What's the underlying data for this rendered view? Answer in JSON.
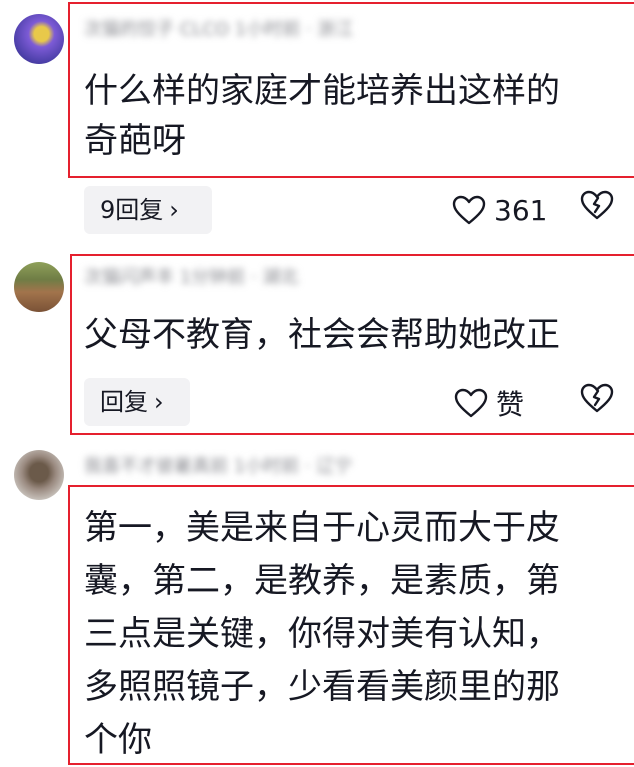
{
  "comments": [
    {
      "author_meta": "次猫的饺子 CLCO  1小时前 · 浙江",
      "text": "什么样的家庭才能培养出这样的\n奇葩呀",
      "reply_label": "9回复",
      "likes": "361"
    },
    {
      "author_meta": "次猫闪声丰  1分钟前 · 湖北",
      "text": "父母不教育，社会会帮助她改正",
      "reply_label": "回复",
      "likes": "赞"
    },
    {
      "author_meta": "我喜不才彼暑真前  1小时前 · 辽宁",
      "text": "第一，美是来自于心灵而大于皮\n囊，第二，是教养，是素质，第\n三点是关键，你得对美有认知，\n多照照镜子，少看看美颜里的那\n个你"
    }
  ],
  "colors": {
    "highlight_border": "#e5202e",
    "meta_text": "#8a8b91",
    "pill_bg": "#f2f2f4"
  },
  "icons": {
    "reply_chevron": "chevron-right-icon",
    "like": "heart-outline-icon",
    "dislike": "broken-heart-icon"
  }
}
